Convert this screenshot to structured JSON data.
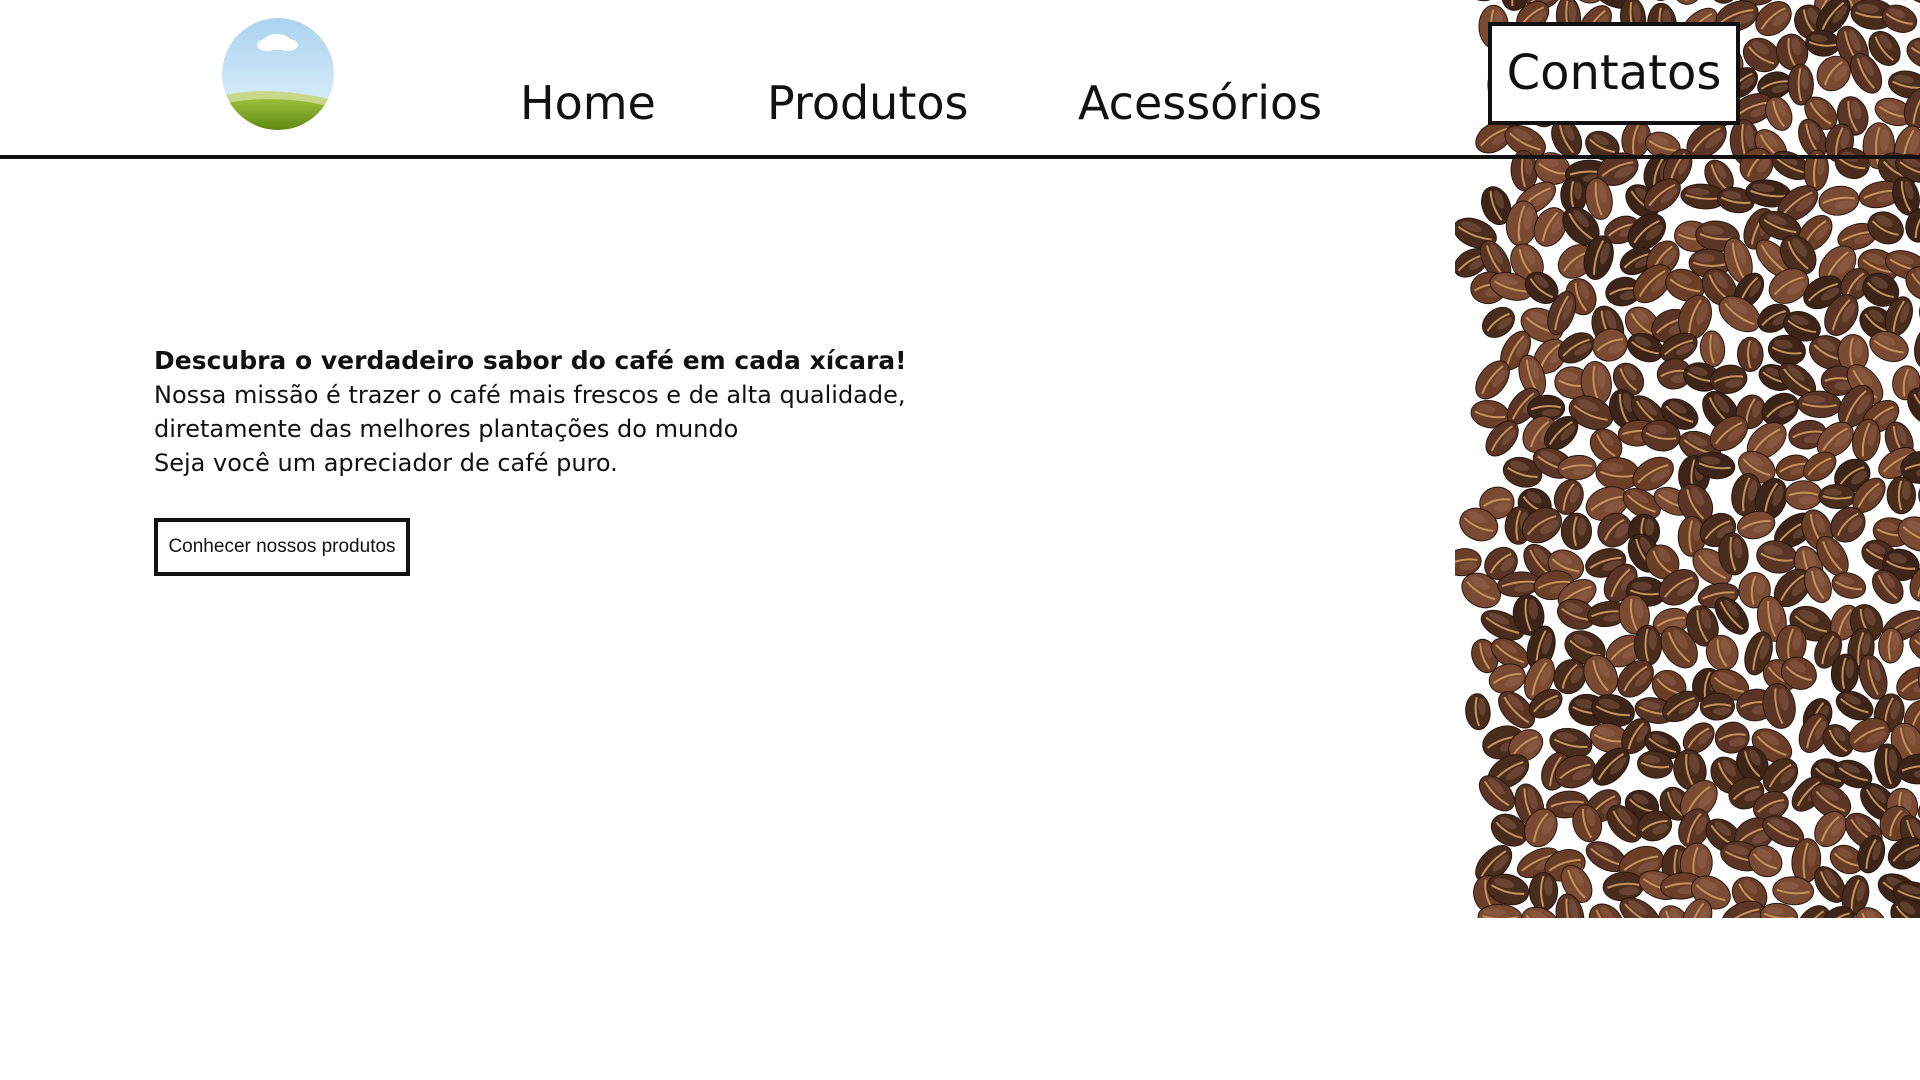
{
  "header": {
    "logo_alt": "logo",
    "nav": [
      {
        "label": "Home"
      },
      {
        "label": "Produtos"
      },
      {
        "label": "Acessórios"
      }
    ],
    "contact_label": "Contatos"
  },
  "hero": {
    "title": "Descubra o verdadeiro sabor do café em cada xícara!",
    "lines": [
      "Nossa missão é trazer o café mais frescos e de alta qualidade,",
      "diretamente das melhores plantações do mundo",
      "Seja você um apreciador de café puro."
    ],
    "cta_label": "Conhecer nossos produtos"
  },
  "colors": {
    "background": "#ffffff",
    "text": "#111111",
    "logo_sky": "#cfe6f6",
    "logo_grass": "#7fa51c",
    "bean_dark": "#3d2418",
    "bean_mid": "#5a3525",
    "bean_light": "#7a4a33"
  },
  "icons": {
    "logo": "landscape-logo-icon",
    "beans": "coffee-beans-image"
  }
}
